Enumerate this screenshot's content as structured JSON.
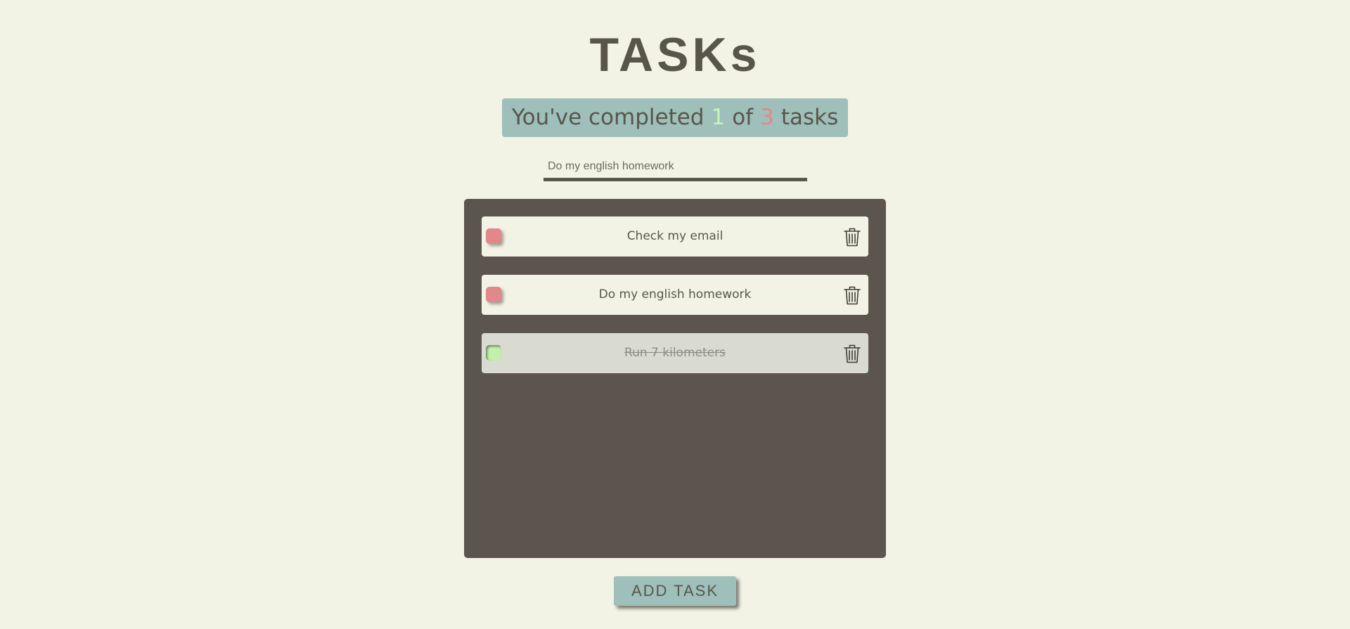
{
  "header": {
    "title": "TASKs"
  },
  "summary": {
    "prefix": "You've completed",
    "completed": "1",
    "middle": "of",
    "total": "3",
    "suffix": "tasks"
  },
  "new_task": {
    "placeholder": "Do my english homework",
    "value": ""
  },
  "tasks": [
    {
      "label": "Check my email",
      "completed": false
    },
    {
      "label": "Do my english homework",
      "completed": false
    },
    {
      "label": "Run 7 kilometers",
      "completed": true
    }
  ],
  "actions": {
    "add_label": "ADD TASK"
  },
  "colors": {
    "background": "#f3f3e5",
    "text": "#58564b",
    "accent": "#9ebfba",
    "board": "#5b554e",
    "pending": "#e2888a",
    "done": "#c3f0ad"
  },
  "icons": {
    "delete": "trash-icon"
  }
}
